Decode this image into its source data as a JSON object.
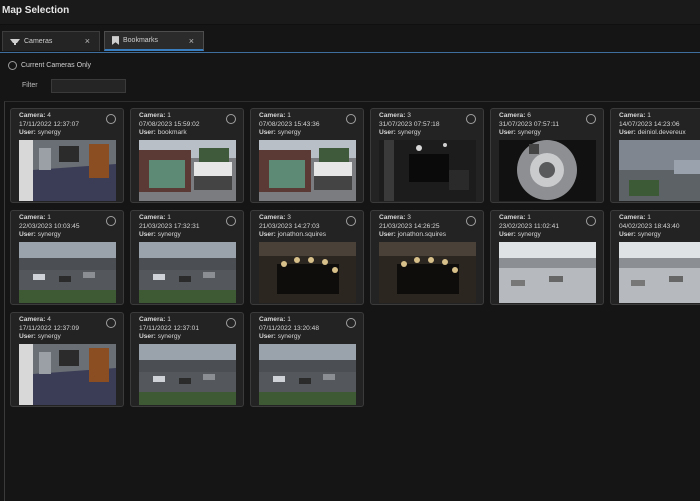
{
  "window": {
    "title": "Map Selection"
  },
  "tabs": [
    {
      "label": "Cameras",
      "icon": "camera-icon",
      "close": "×"
    },
    {
      "label": "Bookmarks",
      "icon": "bookmark-icon",
      "close": "×"
    }
  ],
  "current_only": {
    "label": "Current Cameras Only"
  },
  "filter": {
    "label": "Filter",
    "value": ""
  },
  "labels": {
    "camera": "Camera:",
    "user": "User:"
  },
  "cards": [
    {
      "camera": "4",
      "datetime": "17/11/2022 12:37:07",
      "user": "synergy",
      "scene": "lobby"
    },
    {
      "camera": "1",
      "datetime": "07/08/2023 15:59:02",
      "user": "bookmark",
      "scene": "van"
    },
    {
      "camera": "1",
      "datetime": "07/08/2023 15:43:36",
      "user": "synergy",
      "scene": "van"
    },
    {
      "camera": "3",
      "datetime": "31/07/2023 07:57:18",
      "user": "synergy",
      "scene": "dark-room"
    },
    {
      "camera": "6",
      "datetime": "31/07/2023 07:57:11",
      "user": "synergy",
      "scene": "fisheye"
    },
    {
      "camera": "1",
      "datetime": "14/07/2023 14:23:06",
      "user": "deiniol.devereux",
      "scene": "rain"
    },
    {
      "camera": "1",
      "datetime": "22/03/2023 10:03:45",
      "user": "synergy",
      "scene": "carpark"
    },
    {
      "camera": "1",
      "datetime": "21/03/2023 17:32:31",
      "user": "synergy",
      "scene": "carpark"
    },
    {
      "camera": "3",
      "datetime": "21/03/2023 14:27:03",
      "user": "jonathon.squires",
      "scene": "meeting"
    },
    {
      "camera": "3",
      "datetime": "21/03/2023 14:26:25",
      "user": "jonathon.squires",
      "scene": "meeting"
    },
    {
      "camera": "1",
      "datetime": "23/02/2023 11:02:41",
      "user": "synergy",
      "scene": "snow"
    },
    {
      "camera": "1",
      "datetime": "04/02/2023 18:43:40",
      "user": "synergy",
      "scene": "snow"
    },
    {
      "camera": "4",
      "datetime": "17/11/2022 12:37:09",
      "user": "synergy",
      "scene": "lobby"
    },
    {
      "camera": "1",
      "datetime": "17/11/2022 12:37:01",
      "user": "synergy",
      "scene": "carpark"
    },
    {
      "camera": "1",
      "datetime": "07/11/2022 13:20:48",
      "user": "synergy",
      "scene": "carpark"
    }
  ],
  "colors": {
    "accent": "#3a7ebf",
    "background": "#151515",
    "card": "#232323"
  }
}
